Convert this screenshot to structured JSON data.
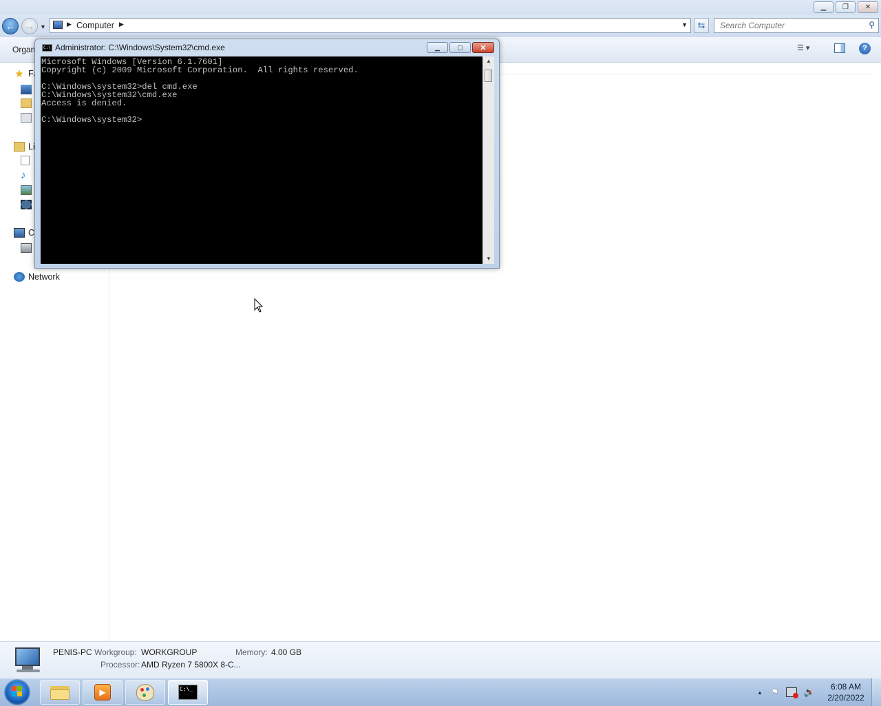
{
  "explorer": {
    "address": {
      "location": "Computer",
      "search_placeholder": "Search Computer"
    },
    "toolbar": {
      "organize_label": "Organ"
    },
    "nav": {
      "favorites_label": "Fa",
      "libraries_label": "Li",
      "computer_label": "C",
      "network_label": "Network"
    },
    "details": {
      "computer_name": "PENIS-PC",
      "workgroup_label": "Workgroup:",
      "workgroup_value": "WORKGROUP",
      "memory_label": "Memory:",
      "memory_value": "4.00 GB",
      "processor_label": "Processor:",
      "processor_value": "AMD Ryzen 7 5800X 8-C..."
    }
  },
  "cmd": {
    "title": "Administrator: C:\\Windows\\System32\\cmd.exe",
    "icon_text": "C:\\",
    "console_lines": [
      "Microsoft Windows [Version 6.1.7601]",
      "Copyright (c) 2009 Microsoft Corporation.  All rights reserved.",
      "",
      "C:\\Windows\\system32>del cmd.exe",
      "C:\\Windows\\system32\\cmd.exe",
      "Access is denied.",
      "",
      "C:\\Windows\\system32>"
    ]
  },
  "taskbar": {
    "items": [
      {
        "name": "windows-explorer",
        "icon": "folder-icon"
      },
      {
        "name": "windows-media-player",
        "icon": "media-player-icon"
      },
      {
        "name": "paint",
        "icon": "paint-palette-icon"
      },
      {
        "name": "command-prompt",
        "icon": "cmd-icon",
        "active": true
      }
    ],
    "clock": {
      "time": "6:08 AM",
      "date": "2/20/2022"
    }
  },
  "colors": {
    "console_bg": "#000000",
    "console_text": "#c0c0c0",
    "taskbar": "#a9c3e2",
    "close_red": "#c9452f"
  }
}
